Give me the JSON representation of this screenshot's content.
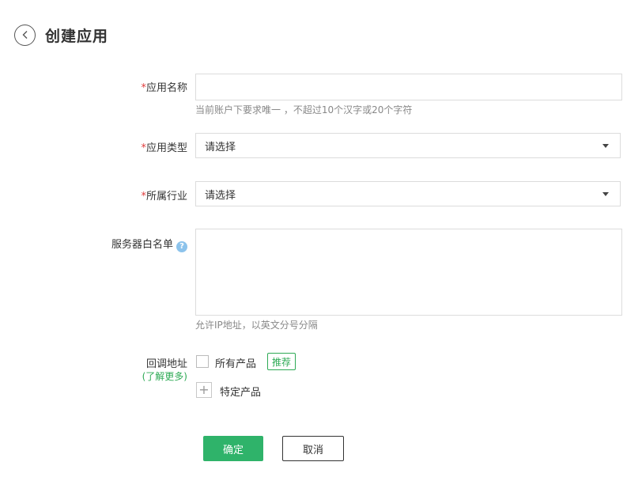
{
  "header": {
    "title": "创建应用",
    "back_icon": "chevron-left-icon"
  },
  "form": {
    "app_name": {
      "required_mark": "*",
      "label": "应用名称",
      "value": "",
      "hint": "当前账户下要求唯一 ，不超过10个汉字或20个字符"
    },
    "app_type": {
      "required_mark": "*",
      "label": "应用类型",
      "selected": "请选择"
    },
    "industry": {
      "required_mark": "*",
      "label": "所属行业",
      "selected": "请选择"
    },
    "whitelist": {
      "label": "服务器白名单",
      "help_icon": "question-circle-icon",
      "value": "",
      "hint": "允许IP地址，以英文分号分隔"
    },
    "callback": {
      "label": "回调地址",
      "learn_more": "(了解更多)",
      "all_products_label": "所有产品",
      "all_products_checked": false,
      "recommend_badge": "推荐",
      "add_icon": "plus-icon",
      "specific_products_label": "特定产品"
    }
  },
  "actions": {
    "confirm": "确定",
    "cancel": "取消"
  },
  "colors": {
    "primary": "#2fb36a",
    "required": "#e03c3c",
    "link": "#2eaa55",
    "help": "#8cc3ec"
  }
}
